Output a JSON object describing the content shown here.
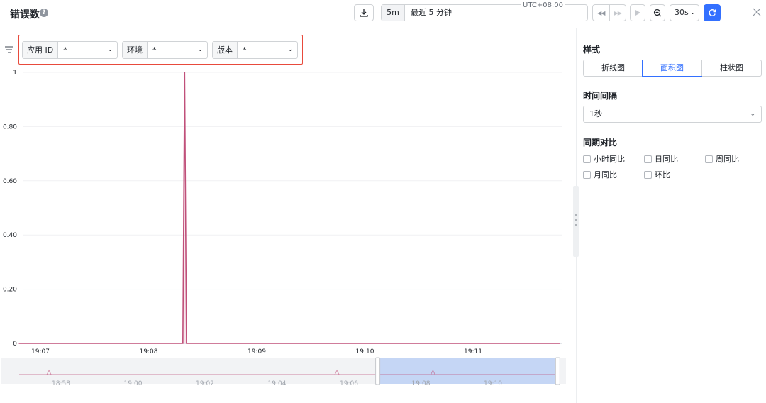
{
  "header": {
    "title": "错误数",
    "help_symbol": "?",
    "time_quick": "5m",
    "time_label": "最近 5 分钟",
    "timezone": "UTC+08:00",
    "interval": "30s",
    "interval_chevron": "⌄"
  },
  "filters": [
    {
      "label": "应用 ID",
      "value": "*"
    },
    {
      "label": "环境",
      "value": "*"
    },
    {
      "label": "版本",
      "value": "*"
    }
  ],
  "panel": {
    "style_title": "样式",
    "style_options": [
      "折线图",
      "面积图",
      "柱状图"
    ],
    "style_selected": "面积图",
    "interval_title": "时间间隔",
    "interval_value": "1秒",
    "compare_title": "同期对比",
    "compare_options": [
      "小时同比",
      "日同比",
      "周同比",
      "月同比",
      "环比"
    ]
  },
  "colors": {
    "accent": "#3370ff",
    "series": "#c0507a",
    "highlight_border": "#e84a3c",
    "overview_selection": "#c5d6f5"
  },
  "chart_data": {
    "type": "area",
    "y_ticks": [
      "0",
      "0.20",
      "0.40",
      "0.60",
      "0.80",
      "1"
    ],
    "ylim": [
      0,
      1
    ],
    "x_ticks": [
      "19:07",
      "19:08",
      "19:09",
      "19:10",
      "19:11"
    ],
    "series": [
      {
        "points": [
          {
            "x": "19:06:48",
            "y": 0
          },
          {
            "x": "19:08:19",
            "y": 0
          },
          {
            "x": "19:08:20",
            "y": 1
          },
          {
            "x": "19:08:21",
            "y": 0
          },
          {
            "x": "19:11:48",
            "y": 0
          }
        ]
      }
    ],
    "overview": {
      "x_ticks": [
        "18:58",
        "19:00",
        "19:02",
        "19:04",
        "19:06",
        "19:08",
        "19:10"
      ],
      "spikes": [
        "18:57:40",
        "19:05:40",
        "19:08:20"
      ],
      "selection": [
        "19:06:48",
        "19:11:48"
      ]
    }
  }
}
